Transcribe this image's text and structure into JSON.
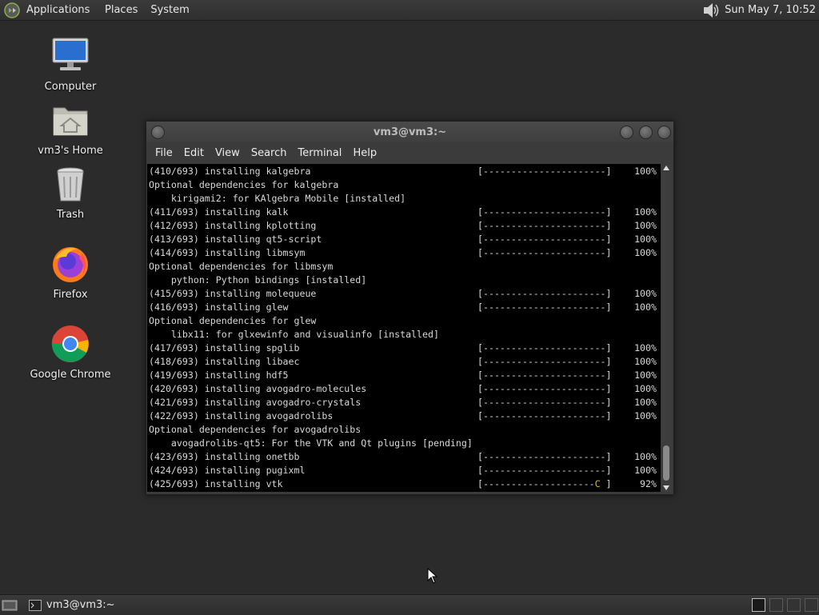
{
  "top_panel": {
    "applications": "Applications",
    "places": "Places",
    "system": "System",
    "clock": "Sun May  7, 10:52",
    "volume_icon": "speaker-icon"
  },
  "desktop_icons": [
    {
      "label": "Computer",
      "icon": "computer-icon"
    },
    {
      "label": "vm3's Home",
      "icon": "home-folder-icon"
    },
    {
      "label": "Trash",
      "icon": "trash-icon"
    },
    {
      "label": "Firefox",
      "icon": "firefox-icon"
    },
    {
      "label": "Google Chrome",
      "icon": "chrome-icon"
    }
  ],
  "terminal": {
    "title": "vm3@vm3:~",
    "menu": [
      "File",
      "Edit",
      "View",
      "Search",
      "Terminal",
      "Help"
    ],
    "lines": [
      {
        "text": "(410/693) installing kalgebra",
        "bar": "[----------------------]",
        "pct": "100%"
      },
      {
        "text": "Optional dependencies for kalgebra"
      },
      {
        "text": "    kirigami2: for KAlgebra Mobile [installed]"
      },
      {
        "text": "(411/693) installing kalk",
        "bar": "[----------------------]",
        "pct": "100%"
      },
      {
        "text": "(412/693) installing kplotting",
        "bar": "[----------------------]",
        "pct": "100%"
      },
      {
        "text": "(413/693) installing qt5-script",
        "bar": "[----------------------]",
        "pct": "100%"
      },
      {
        "text": "(414/693) installing libmsym",
        "bar": "[----------------------]",
        "pct": "100%"
      },
      {
        "text": "Optional dependencies for libmsym"
      },
      {
        "text": "    python: Python bindings [installed]"
      },
      {
        "text": "(415/693) installing molequeue",
        "bar": "[----------------------]",
        "pct": "100%"
      },
      {
        "text": "(416/693) installing glew",
        "bar": "[----------------------]",
        "pct": "100%"
      },
      {
        "text": "Optional dependencies for glew"
      },
      {
        "text": "    libx11: for glxewinfo and visualinfo [installed]"
      },
      {
        "text": "(417/693) installing spglib",
        "bar": "[----------------------]",
        "pct": "100%"
      },
      {
        "text": "(418/693) installing libaec",
        "bar": "[----------------------]",
        "pct": "100%"
      },
      {
        "text": "(419/693) installing hdf5",
        "bar": "[----------------------]",
        "pct": "100%"
      },
      {
        "text": "(420/693) installing avogadro-molecules",
        "bar": "[----------------------]",
        "pct": "100%"
      },
      {
        "text": "(421/693) installing avogadro-crystals",
        "bar": "[----------------------]",
        "pct": "100%"
      },
      {
        "text": "(422/693) installing avogadrolibs",
        "bar": "[----------------------]",
        "pct": "100%"
      },
      {
        "text": "Optional dependencies for avogadrolibs"
      },
      {
        "text": "    avogadrolibs-qt5: For the VTK and Qt plugins [pending]"
      },
      {
        "text": "(423/693) installing onetbb",
        "bar": "[----------------------]",
        "pct": "100%"
      },
      {
        "text": "(424/693) installing pugixml",
        "bar": "[----------------------]",
        "pct": "100%"
      },
      {
        "text": "(425/693) installing vtk",
        "bar_dashes": "[--------------------",
        "bar_cursor": "C",
        "bar_end": " ]",
        "pct": "92%"
      }
    ]
  },
  "taskbar": {
    "window_label": "vm3@vm3:~"
  },
  "colors": {
    "desktop": "#2b2b2b",
    "terminal_bg": "#000000",
    "cursor_accent": "#e0c000"
  }
}
